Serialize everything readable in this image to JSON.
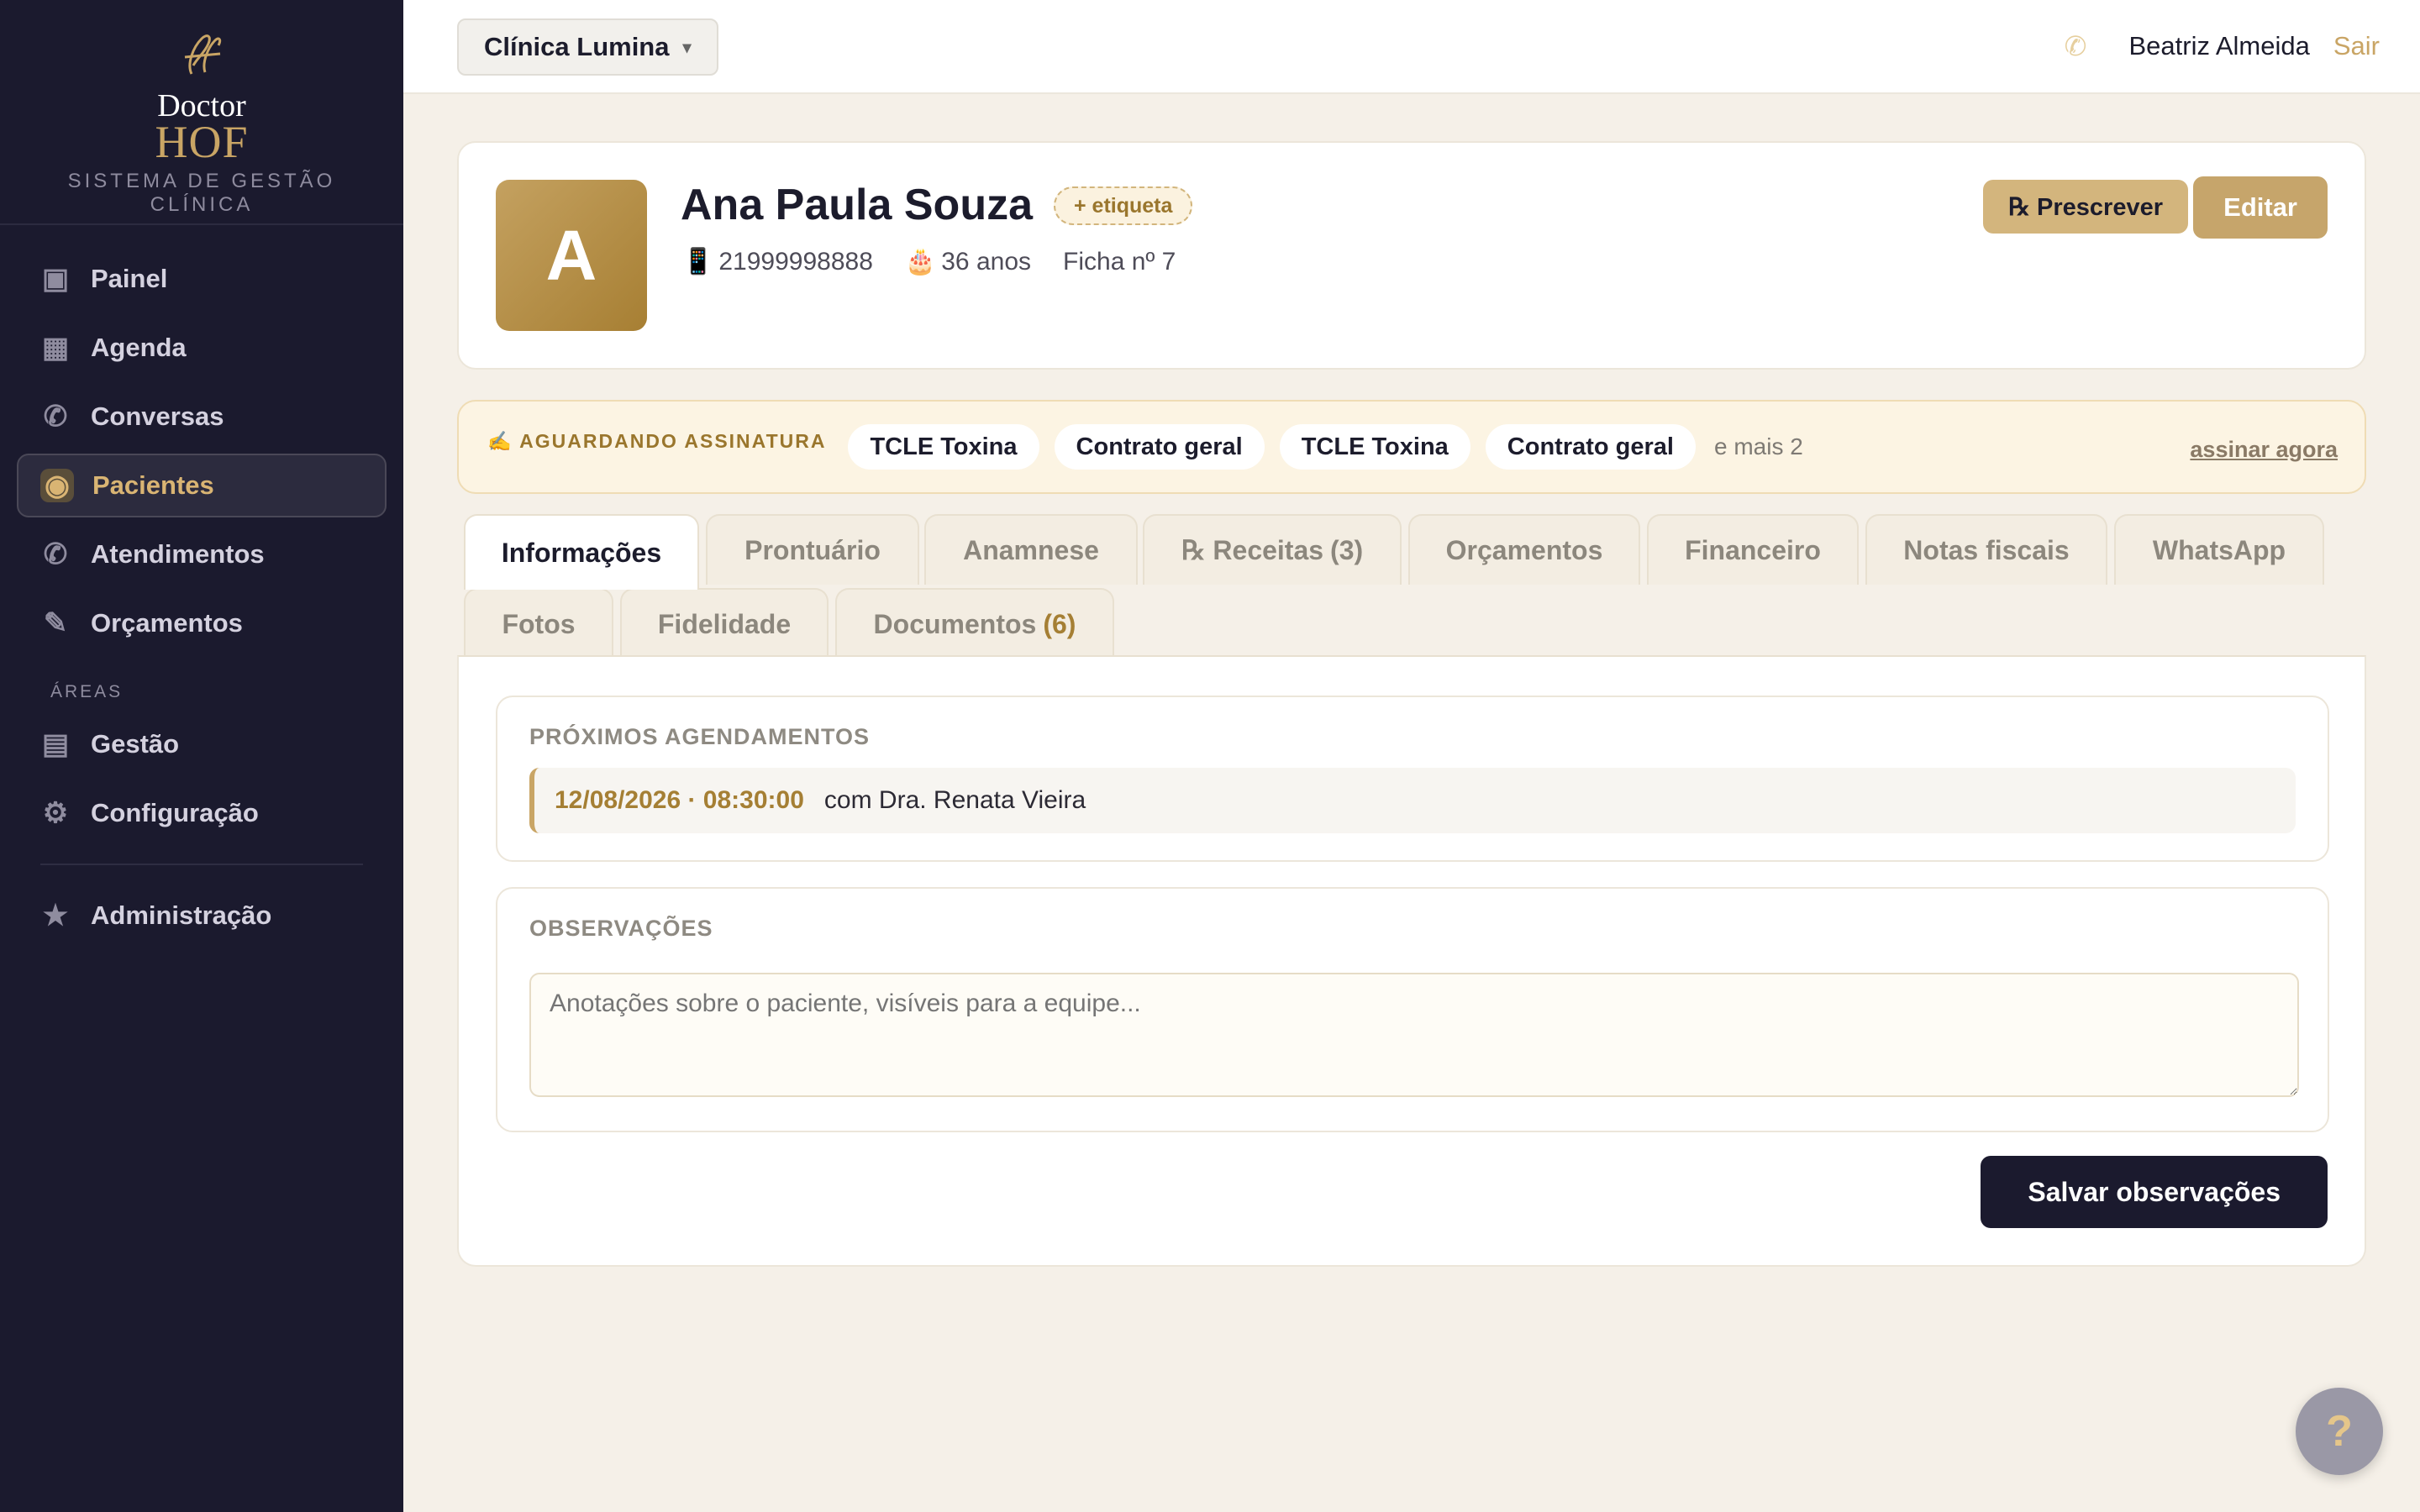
{
  "brand": {
    "doctor": "Doctor",
    "hof": "HOF",
    "subtitle": "SISTEMA DE GESTÃO CLÍNICA"
  },
  "sidebar": {
    "items": [
      {
        "label": "Painel",
        "icon": "dashboard-icon",
        "glyph": "▣"
      },
      {
        "label": "Agenda",
        "icon": "calendar-icon",
        "glyph": "▦"
      },
      {
        "label": "Conversas",
        "icon": "whatsapp-icon",
        "glyph": "✆"
      },
      {
        "label": "Pacientes",
        "icon": "patient-icon",
        "glyph": "◉",
        "active": true
      },
      {
        "label": "Atendimentos",
        "icon": "whatsapp-icon",
        "glyph": "✆"
      },
      {
        "label": "Orçamentos",
        "icon": "pencil-icon",
        "glyph": "✎"
      }
    ],
    "section_label": "ÁREAS",
    "area_items": [
      {
        "label": "Gestão",
        "icon": "document-icon",
        "glyph": "▤"
      },
      {
        "label": "Configuração",
        "icon": "gear-icon",
        "glyph": "⚙"
      }
    ],
    "admin_item": {
      "label": "Administração",
      "icon": "star-icon",
      "glyph": "★"
    }
  },
  "topbar": {
    "clinic": "Clínica Lumina",
    "caret": "▾",
    "phone_glyph": "✆",
    "user_name": "Beatriz Almeida",
    "logout": "Sair"
  },
  "patient": {
    "initial": "A",
    "name": "Ana Paula Souza",
    "tag_button": "+ etiqueta",
    "phone_glyph": "📱",
    "phone": "21999998888",
    "age_glyph": "🎂",
    "age": "36 anos",
    "record": "Ficha nº 7",
    "prescribe_button": "℞ Prescrever",
    "edit_button": "Editar"
  },
  "signature": {
    "label": "✍ AGUARDANDO ASSINATURA",
    "documents": [
      "TCLE Toxina",
      "Contrato geral",
      "TCLE Toxina",
      "Contrato geral"
    ],
    "more": "e mais 2",
    "action": "assinar agora"
  },
  "tabs": {
    "informacoes": "Informações",
    "prontuario": "Prontuário",
    "anamnese": "Anamnese",
    "receitas": "℞ Receitas",
    "receitas_count": "(3)",
    "orcamentos": "Orçamentos",
    "financeiro": "Financeiro",
    "notas": "Notas fiscais",
    "whatsapp": "WhatsApp",
    "fotos": "Fotos",
    "fidelidade": "Fidelidade",
    "documentos": "Documentos",
    "documentos_count": "(6)"
  },
  "appointments": {
    "title": "PRÓXIMOS AGENDAMENTOS",
    "items": [
      {
        "datetime": "12/08/2026 · 08:30:00",
        "with": "com Dra. Renata Vieira"
      }
    ]
  },
  "notes": {
    "title": "OBSERVAÇÕES",
    "placeholder": "Anotações sobre o paciente, visíveis para a equipe...",
    "save_button": "Salvar observações"
  },
  "help": {
    "label": "?"
  }
}
